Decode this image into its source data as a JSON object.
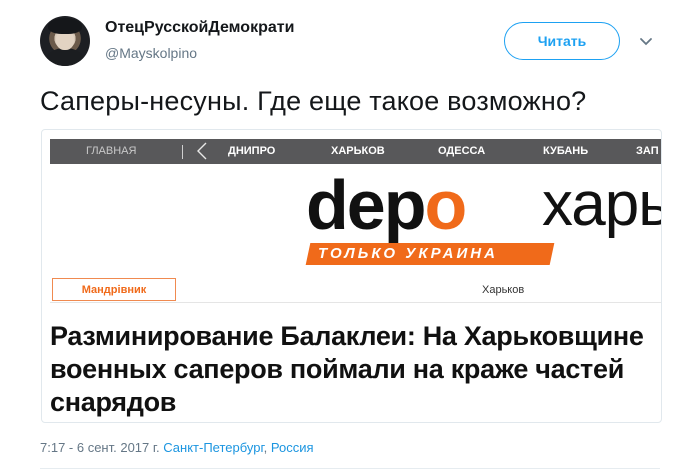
{
  "tweet": {
    "author": {
      "display_name": "ОтецРусскойДемократи",
      "handle": "@Mayskolpino"
    },
    "follow_label": "Читать",
    "text": "Саперы-несуны. Где еще такое возможно?",
    "time": "7:17 - 6 сент. 2017 г.",
    "location_city": "Санкт-Петербург",
    "location_sep": ", ",
    "location_country": "Россия"
  },
  "card": {
    "nav": {
      "home": "ГЛАВНАЯ",
      "items": [
        "ДНИПРО",
        "ХАРЬКОВ",
        "ОДЕССА",
        "КУБАНЬ",
        "ЗАП"
      ]
    },
    "logo": {
      "depo_start": "dep",
      "depo_o": "o",
      "city": "харь",
      "tagline": "ТОЛЬКО УКРАИНА"
    },
    "category": "Мандрівник",
    "region": "Харьков",
    "headline": "Разминирование Балаклеи: На Харьковщине военных саперов поймали на краже частей снарядов"
  },
  "colors": {
    "accent": "#1da1f2",
    "link": "#1b95e0",
    "brand_orange": "#f06a1a",
    "nav_bg": "#58585a"
  }
}
